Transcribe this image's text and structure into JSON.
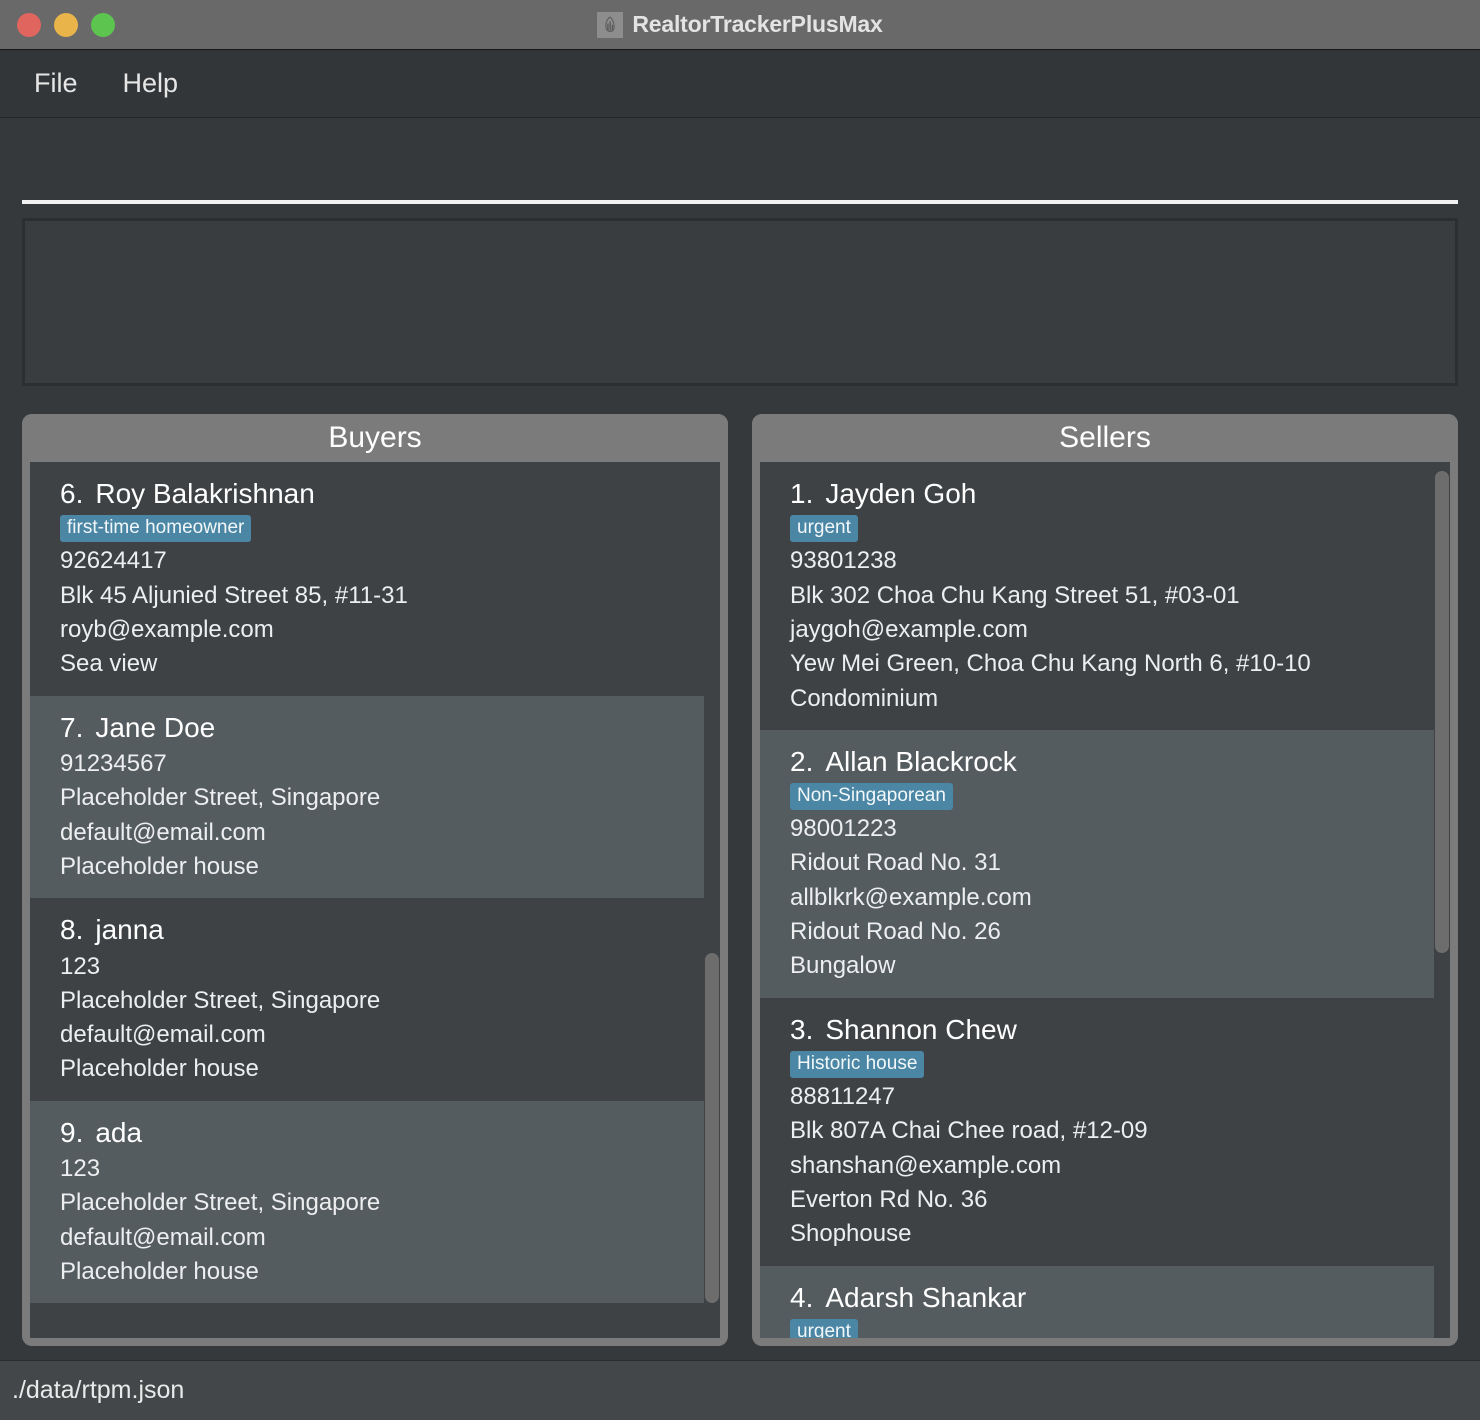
{
  "window": {
    "title": "RealtorTrackerPlusMax",
    "icon": "building-chart-icon",
    "controls": [
      {
        "name": "close",
        "color": "#e0655f"
      },
      {
        "name": "minimize",
        "color": "#e9b44a"
      },
      {
        "name": "maximize",
        "color": "#5cc44f"
      }
    ]
  },
  "menubar": {
    "items": [
      {
        "label": "File"
      },
      {
        "label": "Help"
      }
    ]
  },
  "search": {
    "value": "",
    "placeholder": ""
  },
  "detail_box": {
    "content": ""
  },
  "theme": {
    "badge_color": "#4b87a4",
    "panel_header_bg": "#7b7b7b",
    "row_bg": "#3e4245",
    "row_alt_bg": "#555c60"
  },
  "panels": [
    {
      "id": "buyers",
      "title": "Buyers",
      "scroll": {
        "thumb_top_pct": 56,
        "thumb_height_pct": 40
      },
      "items": [
        {
          "index": "6.",
          "name": "Roy Balakrishnan",
          "badge": "first-time homeowner",
          "lines": [
            "92624417",
            "Blk 45 Aljunied Street 85, #11-31",
            "royb@example.com",
            "Sea view"
          ]
        },
        {
          "index": "7.",
          "name": "Jane Doe",
          "badge": "",
          "lines": [
            "91234567",
            "Placeholder Street, Singapore",
            "default@email.com",
            "Placeholder house"
          ]
        },
        {
          "index": "8.",
          "name": "janna",
          "badge": "",
          "lines": [
            "123",
            "Placeholder Street, Singapore",
            "default@email.com",
            "Placeholder house"
          ]
        },
        {
          "index": "9.",
          "name": "ada",
          "badge": "",
          "lines": [
            "123",
            "Placeholder Street, Singapore",
            "default@email.com",
            "Placeholder house"
          ]
        }
      ]
    },
    {
      "id": "sellers",
      "title": "Sellers",
      "scroll": {
        "thumb_top_pct": 1,
        "thumb_height_pct": 55
      },
      "items": [
        {
          "index": "1.",
          "name": "Jayden Goh",
          "badge": "urgent",
          "lines": [
            "93801238",
            "Blk 302 Choa Chu Kang Street 51, #03-01",
            "jaygoh@example.com",
            "Yew Mei Green, Choa Chu Kang North 6, #10-10",
            "Condominium"
          ]
        },
        {
          "index": "2.",
          "name": "Allan Blackrock",
          "badge": "Non-Singaporean",
          "lines": [
            "98001223",
            "Ridout Road No. 31",
            "allblkrk@example.com",
            "Ridout Road No. 26",
            "Bungalow"
          ]
        },
        {
          "index": "3.",
          "name": "Shannon Chew",
          "badge": "Historic house",
          "lines": [
            "88811247",
            "Blk 807A Chai Chee road, #12-09",
            "shanshan@example.com",
            "Everton Rd No. 36",
            "Shophouse"
          ]
        },
        {
          "index": "4.",
          "name": "Adarsh Shankar",
          "badge": "urgent",
          "lines": []
        }
      ]
    }
  ],
  "statusbar": {
    "path": "./data/rtpm.json"
  }
}
